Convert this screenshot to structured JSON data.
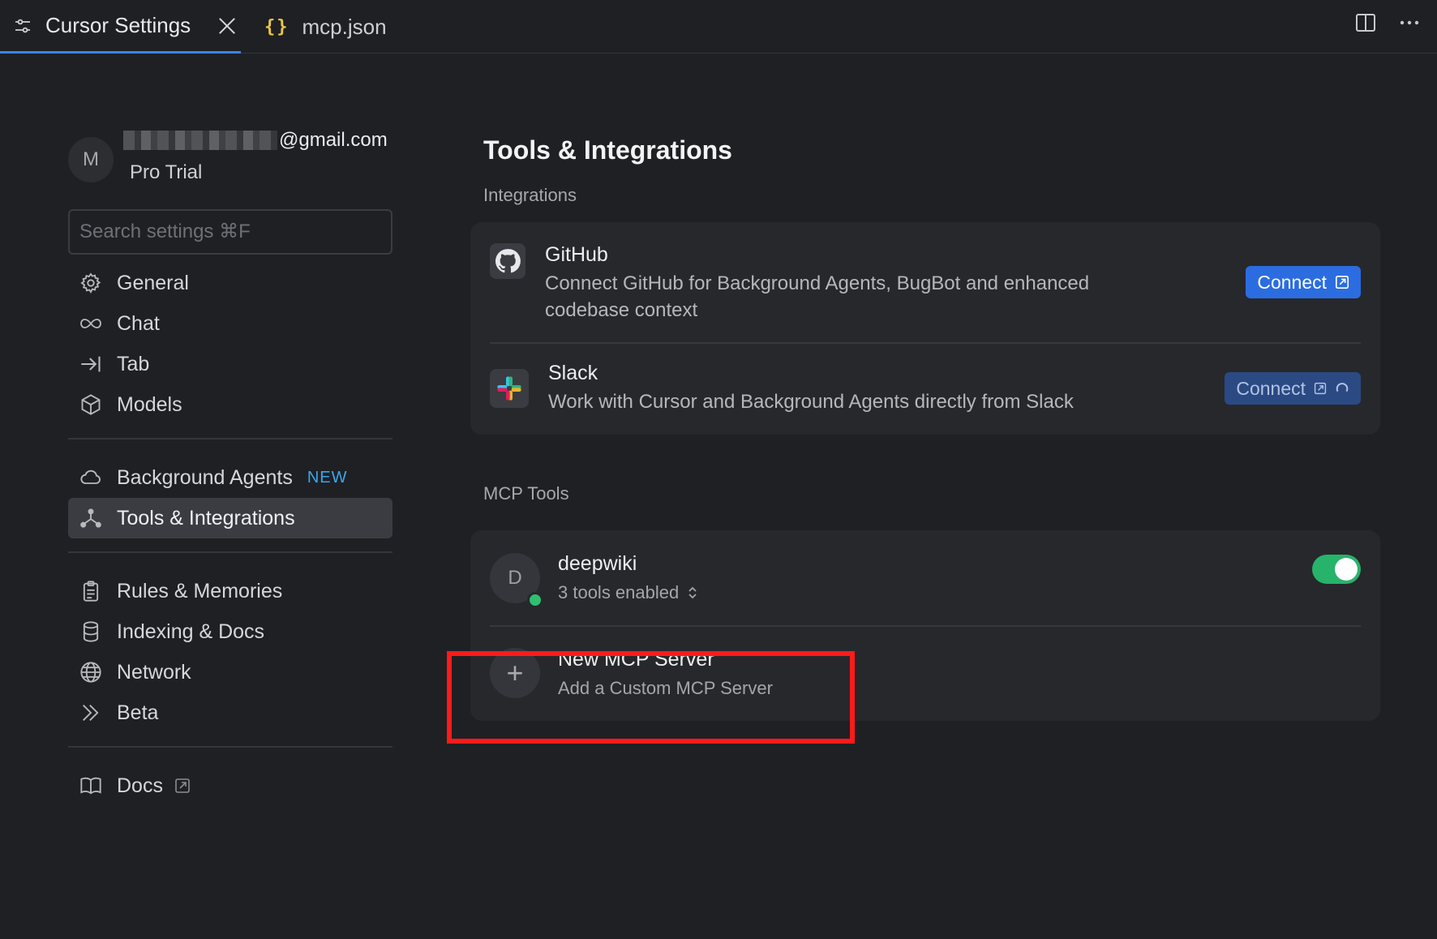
{
  "tabs": [
    {
      "label": "Cursor Settings",
      "icon": "settings-sliders-icon",
      "active": true
    },
    {
      "label": "mcp.json",
      "icon": "json-braces-icon",
      "active": false
    }
  ],
  "account": {
    "avatar_letter": "M",
    "email_visible": "@gmail.com",
    "plan": "Pro Trial"
  },
  "search": {
    "placeholder": "Search settings ⌘F"
  },
  "sidebar": {
    "group1": [
      {
        "label": "General",
        "icon": "gear-icon"
      },
      {
        "label": "Chat",
        "icon": "infinity-icon"
      },
      {
        "label": "Tab",
        "icon": "arrow-right-bar-icon"
      },
      {
        "label": "Models",
        "icon": "cube-icon"
      }
    ],
    "group2": [
      {
        "label": "Background Agents",
        "icon": "cloud-icon",
        "badge": "NEW"
      },
      {
        "label": "Tools & Integrations",
        "icon": "integrations-icon",
        "selected": true
      }
    ],
    "group3": [
      {
        "label": "Rules & Memories",
        "icon": "clipboard-icon"
      },
      {
        "label": "Indexing & Docs",
        "icon": "database-icon"
      },
      {
        "label": "Network",
        "icon": "globe-icon"
      },
      {
        "label": "Beta",
        "icon": "chevrons-right-icon"
      }
    ],
    "group4": [
      {
        "label": "Docs",
        "icon": "book-icon"
      }
    ]
  },
  "main": {
    "title": "Tools & Integrations",
    "integrations_label": "Integrations",
    "integrations": [
      {
        "name": "GitHub",
        "description": "Connect GitHub for Background Agents, BugBot and enhanced codebase context",
        "button": "Connect"
      },
      {
        "name": "Slack",
        "description": "Work with Cursor and Background Agents directly from Slack",
        "button": "Connect"
      }
    ],
    "mcp_label": "MCP Tools",
    "mcp_servers": [
      {
        "avatar_letter": "D",
        "name": "deepwiki",
        "status": "3 tools enabled",
        "enabled": true
      }
    ],
    "new_server": {
      "title": "New MCP Server",
      "subtitle": "Add a Custom MCP Server"
    }
  },
  "colors": {
    "background": "#1f2023",
    "card": "#27282c",
    "accent": "#2b6de0",
    "toggle_on": "#27b36a",
    "status_online": "#2fbf71",
    "badge_new": "#3ba7f0",
    "highlight": "#ff1a1a"
  }
}
